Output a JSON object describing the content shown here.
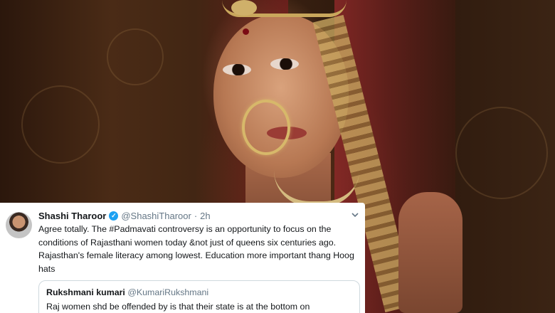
{
  "tweet": {
    "author_name": "Shashi Tharoor",
    "author_handle": "@ShashiTharoor",
    "separator": "·",
    "time": "2h",
    "verified_glyph": "✓",
    "menu_icon": "chevron-down-icon",
    "text": "Agree totally. The #Padmavati controversy is an opportunity to focus on the conditions of Rajasthani women today &not just of queens six centuries ago. Rajasthan's female literacy among lowest. Education more important thang Hoog hats",
    "quoted": {
      "author_name": "Rukshmani kumari",
      "author_handle": "@KumariRukshmani",
      "text": "Raj women shd be offended by is that their state is at the bottom on"
    }
  },
  "colors": {
    "verified": "#1da1f2",
    "text": "#14171a",
    "muted": "#657786"
  }
}
